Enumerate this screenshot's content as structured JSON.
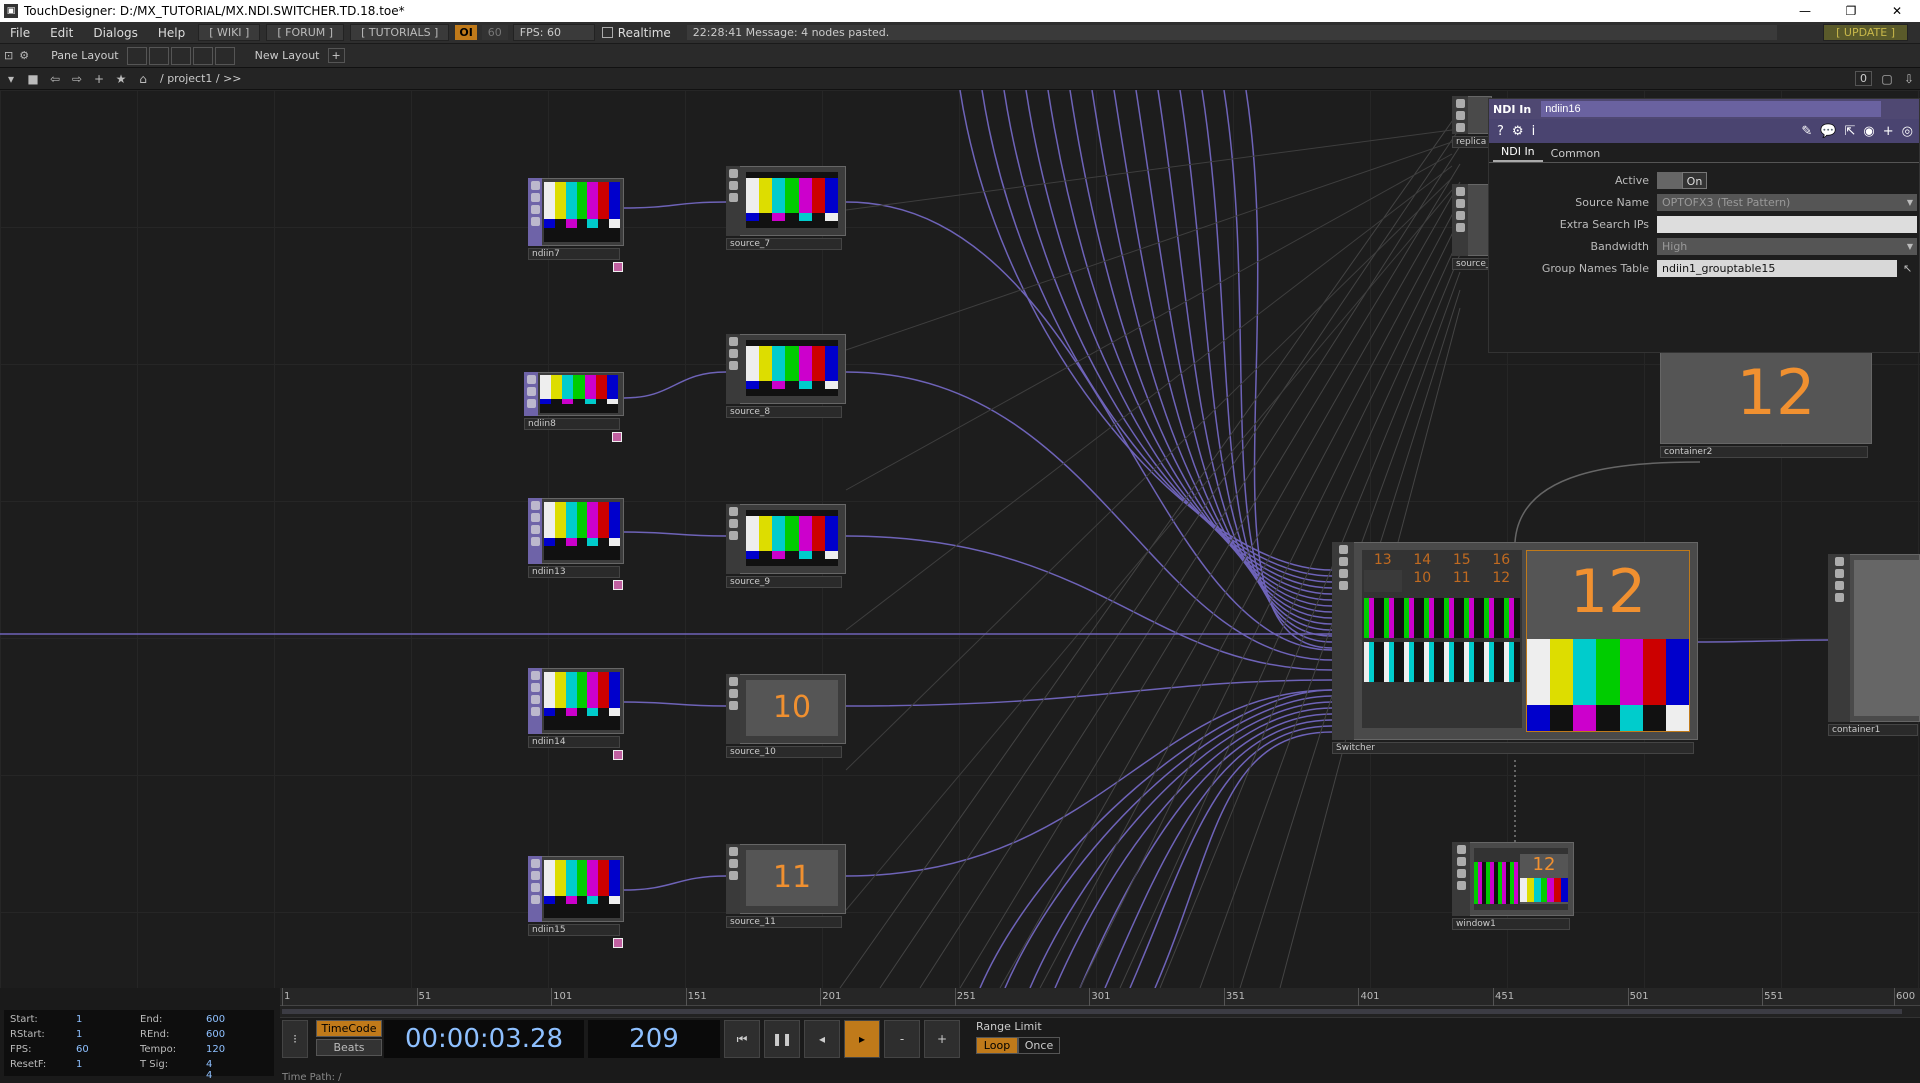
{
  "app": {
    "title": "TouchDesigner: D:/MX_TUTORIAL/MX.NDI.SWITCHER.TD.18.toe*",
    "window_buttons": [
      "—",
      "❐",
      "✕"
    ]
  },
  "menubar": {
    "items": [
      "File",
      "Edit",
      "Dialogs",
      "Help"
    ],
    "links": [
      "[ WIKI ]",
      "[ FORUM ]",
      "[ TUTORIALS ]"
    ],
    "oi": "OI",
    "fps_target": "60",
    "fps_label": "FPS:  60",
    "realtime": "Realtime",
    "message": "22:28:41 Message: 4 nodes pasted.",
    "update": "[ UPDATE ]"
  },
  "panebar": {
    "pane_layout": "Pane Layout",
    "new_layout": "New Layout",
    "plus": "+"
  },
  "pathbar": {
    "path": "/ project1 / >>",
    "right_value": "0"
  },
  "nodes": {
    "ndi_ins": [
      "ndiin7",
      "ndiin8",
      "ndiin13",
      "ndiin14",
      "ndiin15"
    ],
    "sources": [
      "source_7",
      "source_8",
      "source_9",
      "source_10",
      "source_11"
    ],
    "source_numbers": {
      "source_10": "10",
      "source_11": "11"
    },
    "switcher": "Switcher",
    "switcher_big": "12",
    "switcher_grid": [
      "13",
      "14",
      "15",
      "16",
      "10",
      "11",
      "12"
    ],
    "container2": "container2",
    "container2_big": "12",
    "container1": "container1",
    "window1": "window1",
    "window1_number": "12",
    "replica": "replica",
    "source_partial": "source_"
  },
  "params": {
    "op_type": "NDI In",
    "op_name": "ndiin16",
    "tabs": [
      "NDI In",
      "Common"
    ],
    "active_label": "Active",
    "active_value": "On",
    "source_name_label": "Source Name",
    "source_name_value": "OPTOFX3 (Test Pattern)",
    "extra_ips_label": "Extra Search IPs",
    "extra_ips_value": "",
    "bandwidth_label": "Bandwidth",
    "bandwidth_value": "High",
    "group_table_label": "Group Names Table",
    "group_table_value": "ndiin1_grouptable15"
  },
  "timeline": {
    "ruler_ticks": [
      "1",
      "51",
      "101",
      "151",
      "201",
      "251",
      "301",
      "351",
      "401",
      "451",
      "501",
      "551",
      "600"
    ],
    "stats": {
      "start_label": "Start:",
      "start": "1",
      "rstart_label": "RStart:",
      "rstart": "1",
      "fps_label": "FPS:",
      "fps": "60",
      "resetf_label": "ResetF:",
      "resetf": "1",
      "end_label": "End:",
      "end": "600",
      "rend_label": "REnd:",
      "rend": "600",
      "tempo_label": "Tempo:",
      "tempo": "120",
      "tsig_label": "T Sig:",
      "tsig": "4    4"
    },
    "timecode_btn": "TimeCode",
    "beats_btn": "Beats",
    "timecode": "00:00:03.28",
    "frame": "209",
    "range_limit": "Range Limit",
    "loop": "Loop",
    "once": "Once",
    "time_path": "Time Path: /"
  },
  "colors": {
    "wire": "#6e63b8",
    "accent": "#f09030",
    "param_header": "#4f4872"
  }
}
